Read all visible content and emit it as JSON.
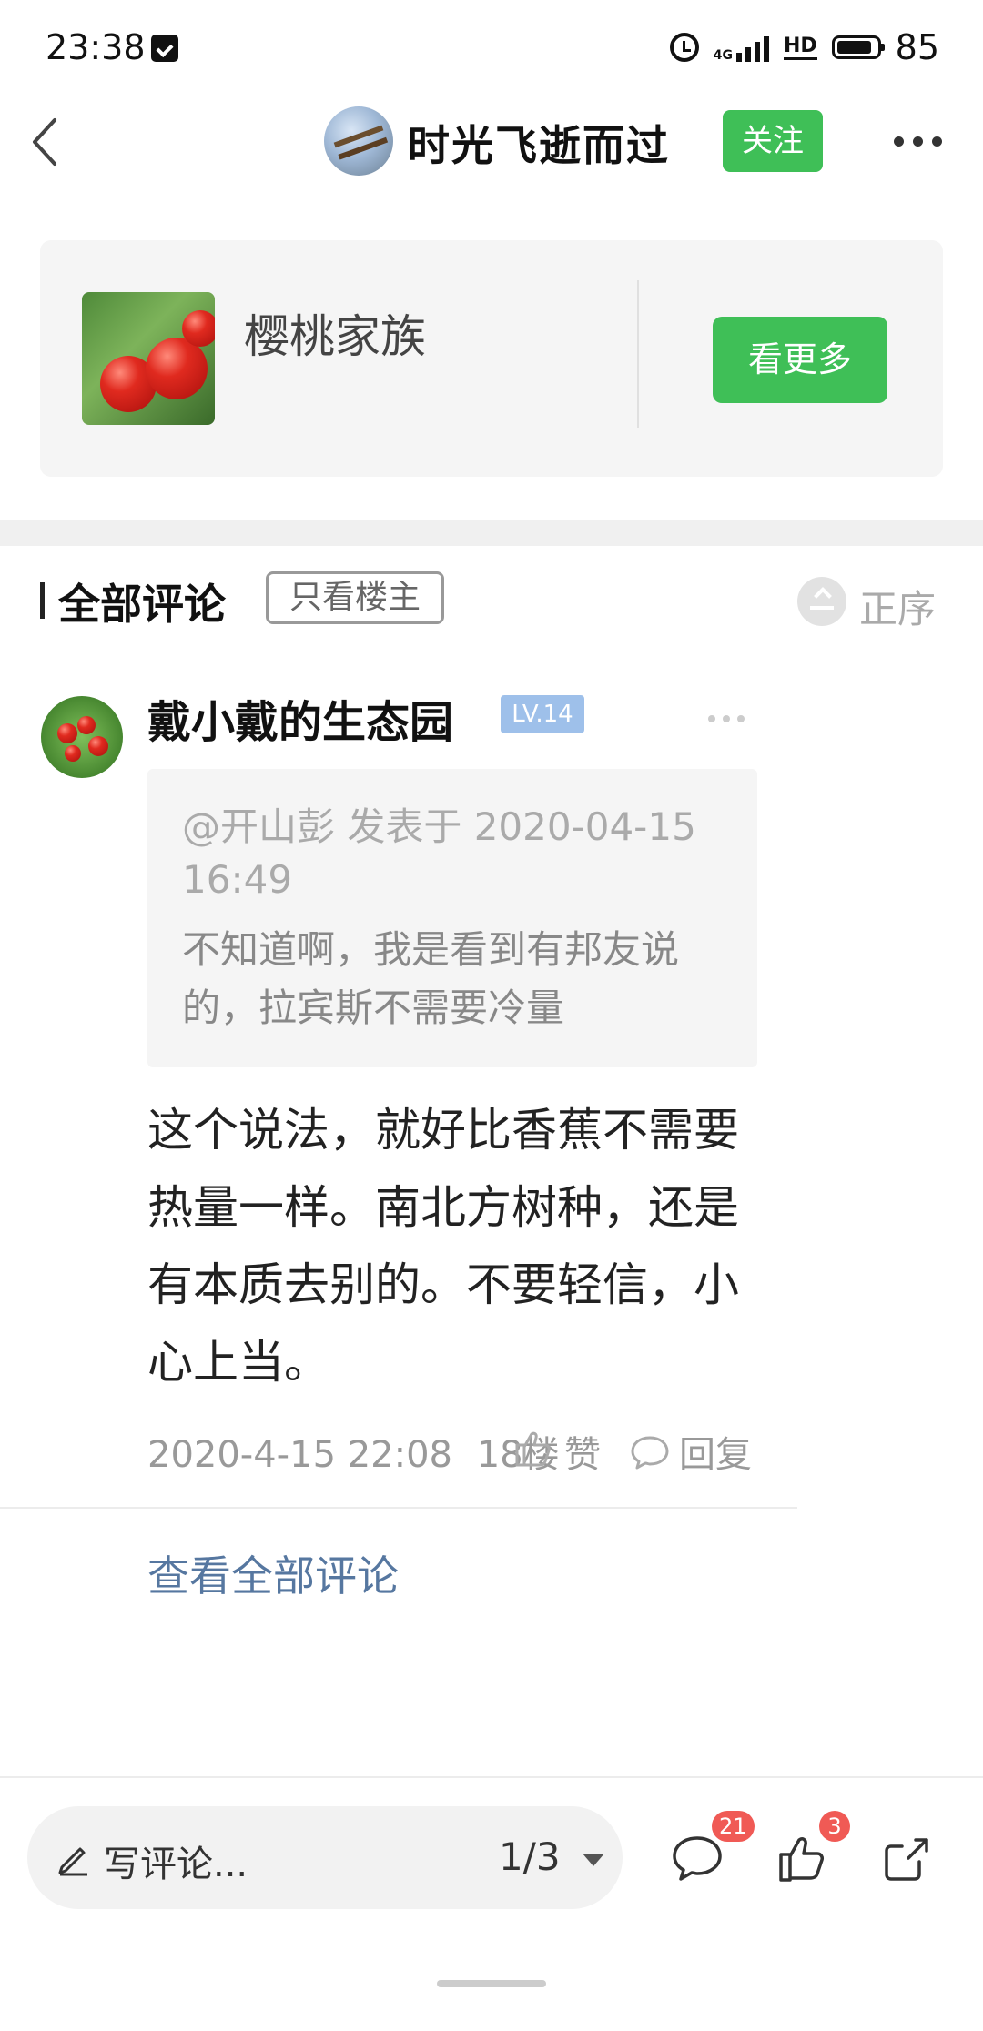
{
  "status_bar": {
    "time": "23:38",
    "network": "4G",
    "battery": "85"
  },
  "header": {
    "name": "时光飞逝而过",
    "follow_label": "关注"
  },
  "group_card": {
    "name": "樱桃家族",
    "see_more_label": "看更多"
  },
  "comments_header": {
    "title": "全部评论",
    "owner_only_label": "只看楼主",
    "sort_label": "正序"
  },
  "comment": {
    "user": "戴小戴的生态园",
    "level": "LV.14",
    "quote": {
      "meta": "@开山彭 发表于 2020-04-15 16:49",
      "text": "不知道啊，我是看到有邦友说的，拉宾斯不需要冷量"
    },
    "body": "这个说法，就好比香蕉不需要热量一样。南北方树种，还是有本质去别的。不要轻信，小心上当。",
    "timestamp": "2020-4-15 22:08",
    "floor": "18楼",
    "like_label": "赞",
    "reply_label": "回复"
  },
  "view_all_label": "查看全部评论",
  "bottom_bar": {
    "write_placeholder": "写评论...",
    "page_indicator": "1/3",
    "comment_count": "21",
    "like_count": "3"
  }
}
